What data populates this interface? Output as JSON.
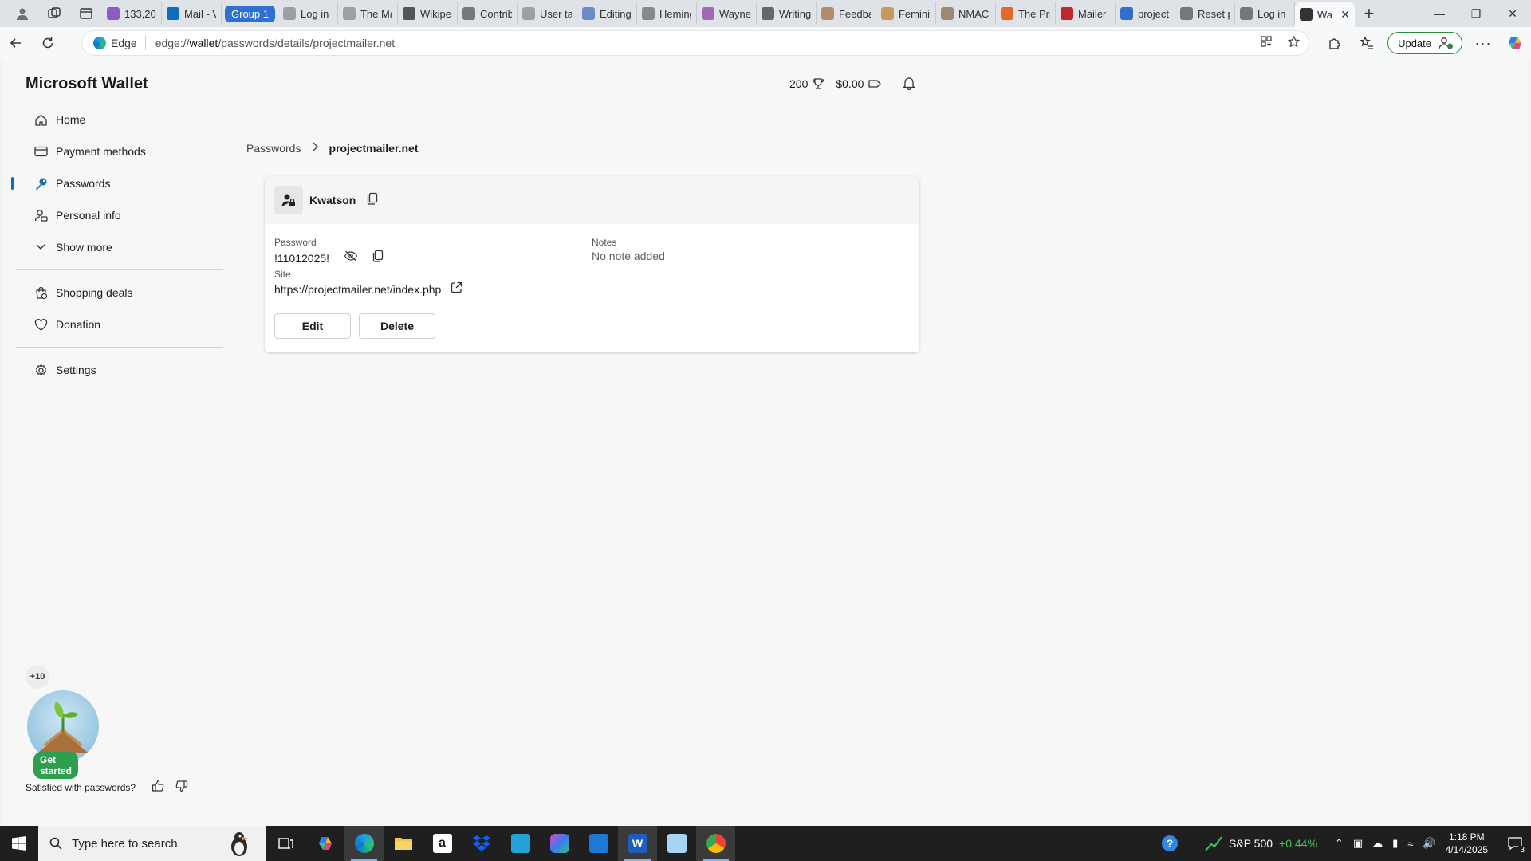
{
  "browser": {
    "tabs": [
      {
        "label": "133,20",
        "color": "#8a5cc8"
      },
      {
        "label": "Mail - V",
        "color": "#0f6cbd"
      },
      {
        "label": "Group 1",
        "group": true
      },
      {
        "label": "Log in",
        "color": "#9aa0a6"
      },
      {
        "label": "The Ma",
        "color": "#9aa0a6"
      },
      {
        "label": "Wikipe",
        "color": "#555555"
      },
      {
        "label": "Contrib",
        "color": "#777777"
      },
      {
        "label": "User ta",
        "color": "#9aa0a6"
      },
      {
        "label": "Editing",
        "color": "#6b8cc4"
      },
      {
        "label": "Heming",
        "color": "#888888"
      },
      {
        "label": "Wayne",
        "color": "#a06ab4"
      },
      {
        "label": "Writing",
        "color": "#666666"
      },
      {
        "label": "Feedba",
        "color": "#b08c6a"
      },
      {
        "label": "Femini",
        "color": "#c89a5a"
      },
      {
        "label": "NMAC",
        "color": "#a08870"
      },
      {
        "label": "The Pri",
        "color": "#e06b2a"
      },
      {
        "label": "Mailer",
        "color": "#c0282e"
      },
      {
        "label": "project",
        "color": "#2f6fd0"
      },
      {
        "label": "Reset p",
        "color": "#777777"
      },
      {
        "label": "Log in",
        "color": "#777777"
      },
      {
        "label": "Wa",
        "active": true,
        "color": "#333333"
      }
    ],
    "address": {
      "edge_label": "Edge",
      "url_prefix": "edge://",
      "url_host": "wallet",
      "url_path": "/passwords/details/projectmailer.net"
    },
    "update_label": "Update"
  },
  "header": {
    "title": "Microsoft Wallet",
    "rewards_points": "200",
    "balance": "$0.00"
  },
  "sidebar": {
    "items": [
      {
        "label": "Home",
        "icon": "home-icon"
      },
      {
        "label": "Payment methods",
        "icon": "card-icon"
      },
      {
        "label": "Passwords",
        "icon": "key-icon",
        "active": true
      },
      {
        "label": "Personal info",
        "icon": "person-icon"
      },
      {
        "label": "Show more",
        "icon": "chevron-down-icon"
      }
    ],
    "items2": [
      {
        "label": "Shopping deals",
        "icon": "shopping-bag-icon"
      },
      {
        "label": "Donation",
        "icon": "heart-icon"
      }
    ],
    "items3": [
      {
        "label": "Settings",
        "icon": "gear-icon"
      }
    ]
  },
  "breadcrumb": {
    "parent": "Passwords",
    "current": "projectmailer.net"
  },
  "credential": {
    "username": "Kwatson",
    "password_label": "Password",
    "password_value": "!11012025!",
    "notes_label": "Notes",
    "notes_value": "No note added",
    "site_label": "Site",
    "site_value": "https://projectmailer.net/index.php",
    "edit_label": "Edit",
    "delete_label": "Delete"
  },
  "promo": {
    "badge": "+10",
    "button": "Get started"
  },
  "feedback": {
    "question": "Satisfied with passwords?"
  },
  "taskbar": {
    "search_placeholder": "Type here to search",
    "stock_name": "S&P 500",
    "stock_change": "+0.44%",
    "time": "1:18 PM",
    "date": "4/14/2025",
    "notification_count": "3"
  },
  "colors": {
    "accent": "#0f6cbd",
    "update_border": "#2a8a3d",
    "get_started": "#2e9e4f",
    "stock_positive": "#3fbf5a"
  }
}
